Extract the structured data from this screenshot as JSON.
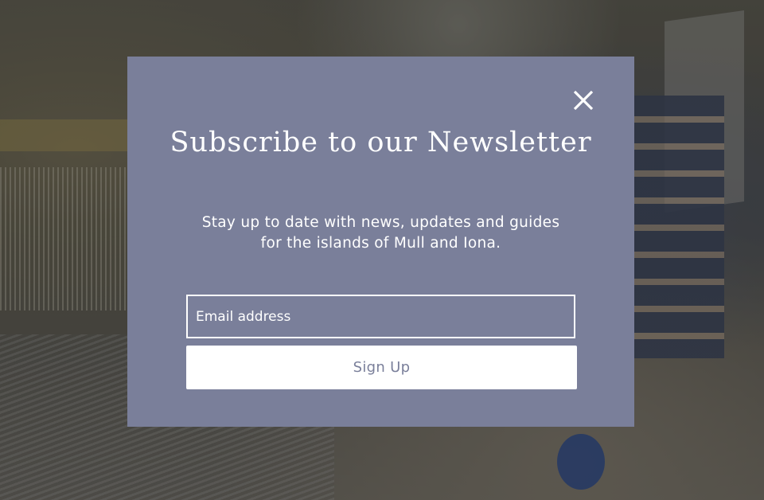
{
  "modal": {
    "title": "Subscribe to our Newsletter",
    "description_line1": "Stay up to date with news, updates and guides",
    "description_line2": "for the islands of Mull and Iona.",
    "email_placeholder": "Email address",
    "email_value": "",
    "signup_label": "Sign Up",
    "close_icon": "close-icon"
  },
  "colors": {
    "modal_background": "#7a7f9a",
    "text": "#ffffff",
    "button_background": "#ffffff",
    "button_text": "#7a7f9a"
  }
}
